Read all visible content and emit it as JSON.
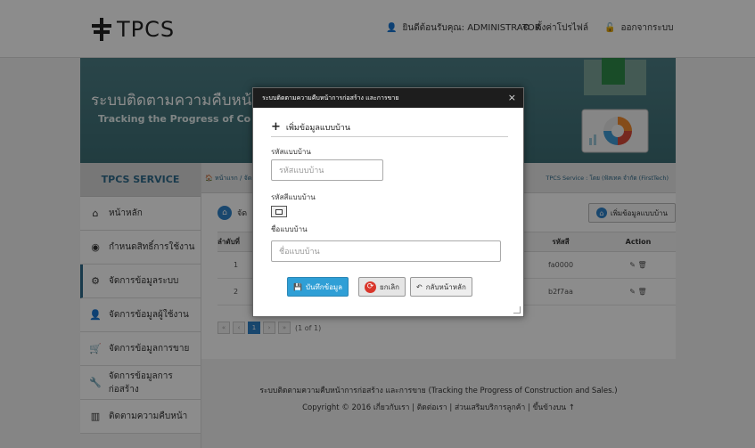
{
  "brand": {
    "logo_text": "TPCS"
  },
  "topnav": {
    "welcome_label": "ยินดีต้อนรับคุณ: ADMINISTRATOR",
    "profile_label": "ตั้งค่าโปรไฟล์",
    "logout_label": "ออกจากระบบ"
  },
  "banner": {
    "title": "ระบบติดตามความคืบหน้าการก่อ",
    "subtitle": "Tracking the Progress of Co"
  },
  "sidebar": {
    "header": "TPCS SERVICE",
    "items": [
      {
        "label": "หน้าหลัก",
        "icon": "home-icon"
      },
      {
        "label": "กำหนดสิทธิ์การใช้งาน",
        "icon": "eye-icon"
      },
      {
        "label": "จัดการข้อมูลระบบ",
        "icon": "gears-icon"
      },
      {
        "label": "จัดการข้อมูลผู้ใช้งาน",
        "icon": "user-icon"
      },
      {
        "label": "จัดการข้อมูลการขาย",
        "icon": "cart-icon"
      },
      {
        "label": "จัดการข้อมูลการก่อสร้าง",
        "icon": "wrench-icon"
      },
      {
        "label": "ติดตามความคืบหน้า",
        "icon": "chart-icon"
      }
    ]
  },
  "breadcrumb": {
    "left": "หน้าแรก / จัดก",
    "right": "TPCS Service : โดย (ฟัสเทค จำกัด (FirstTech)"
  },
  "content": {
    "heading_partial": "จัด",
    "add_button": "เพิ่มข้อมูลแบบบ้าน",
    "table": {
      "headers": [
        "ลำดับที่",
        "รหัสสี",
        "Action"
      ],
      "rows": [
        {
          "no": "1",
          "color_code": "fa0000"
        },
        {
          "no": "2",
          "color_code": "b2f7aa"
        }
      ]
    },
    "pager_text": "(1 of 1)",
    "pager_current": "1"
  },
  "footer": {
    "line1": "ระบบติดตามความคืบหน้าการก่อสร้าง และการขาย  (Tracking the Progress of Construction and Sales.)",
    "copyright": "Copyright © 2016",
    "links": [
      "เกี่ยวกับเรา",
      "ติดต่อเรา",
      "ส่วนเสริมบริการลูกค้า",
      "ขึ้นข้างบน"
    ]
  },
  "modal": {
    "title": "ระบบติดตามความคืบหน้าการก่อสร้าง และการขาย",
    "section": "เพิ่มข้อมูลแบบบ้าน",
    "house_code_label": "รหัสแบบบ้าน",
    "house_code_placeholder": "รหัสแบบบ้าน",
    "color_code_label": "รหัสสีแบบบ้าน",
    "house_name_label": "ชื่อแบบบ้าน",
    "house_name_placeholder": "ชื่อแบบบ้าน",
    "save_button": "บันทึกข้อมูล",
    "cancel_button": "ยกเลิก",
    "back_button": "กลับหน้าหลัก",
    "close_glyph": "×"
  }
}
